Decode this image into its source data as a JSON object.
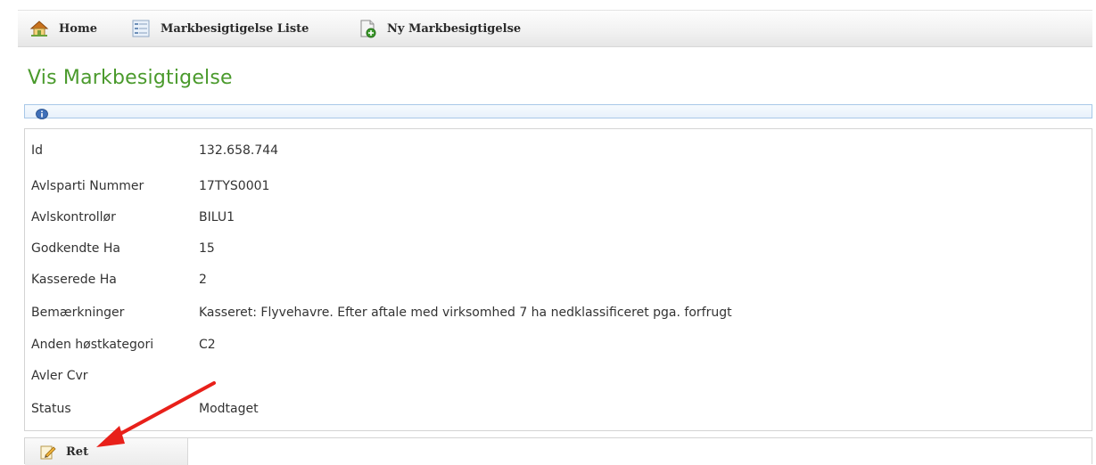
{
  "nav": {
    "items": [
      {
        "label": "Home",
        "icon": "home-icon"
      },
      {
        "label": "Markbesigtigelse Liste",
        "icon": "list-icon"
      },
      {
        "label": "Ny Markbesigtigelse",
        "icon": "new-document-icon"
      }
    ]
  },
  "page": {
    "title": "Vis Markbesigtigelse"
  },
  "info_bar": {
    "icon": "info-icon"
  },
  "details": {
    "rows": [
      {
        "label": "Id",
        "value": "132.658.744"
      },
      {
        "label": "Avlsparti Nummer",
        "value": "17TYS0001"
      },
      {
        "label": "Avlskontrollør",
        "value": "BILU1"
      },
      {
        "label": "Godkendte Ha",
        "value": "15"
      },
      {
        "label": "Kasserede Ha",
        "value": "2"
      },
      {
        "label": "Bemærkninger",
        "value": "Kasseret: Flyvehavre. Efter aftale med virksomhed 7 ha nedklassificeret pga. forfrugt"
      },
      {
        "label": "Anden høstkategori",
        "value": "C2"
      },
      {
        "label": "Avler Cvr",
        "value": ""
      },
      {
        "label": "Status",
        "value": "Modtaget"
      }
    ]
  },
  "actions": {
    "edit_label": "Ret",
    "edit_icon": "edit-pencil-icon"
  },
  "annotation": {
    "arrow_color": "#e8201a",
    "accent_title_color": "#4a9a2c"
  }
}
